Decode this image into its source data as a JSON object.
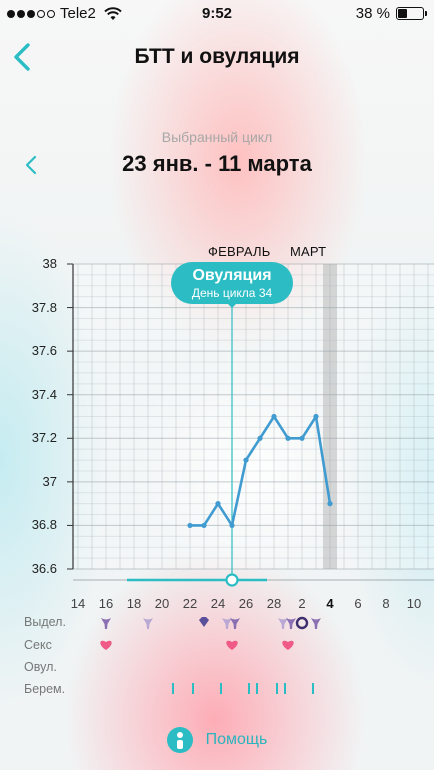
{
  "status_bar": {
    "carrier": "Tele2",
    "time": "9:52",
    "battery_pct": "38 %",
    "battery_level": 0.38,
    "signal_bars_filled": 3,
    "signal_bars_total": 5
  },
  "nav": {
    "back_icon": "chevron-left-icon",
    "title": "БТТ и овуляция"
  },
  "cycle": {
    "caption": "Выбранный цикл",
    "range": "23 янв. - 11 марта",
    "prev_icon": "chevron-left-icon"
  },
  "colors": {
    "accent": "#2cbdc4",
    "line": "#3f9bd0",
    "heart": "#ef5a86",
    "discharge": "#8a6fb3"
  },
  "chart_data": {
    "type": "line",
    "title": "",
    "xlabel": "",
    "ylabel": "",
    "ylim": [
      36.6,
      38
    ],
    "y_ticks": [
      "38",
      "37.8",
      "37.6",
      "37.4",
      "37.2",
      "37",
      "36.8",
      "36.6"
    ],
    "y_tick_values": [
      38,
      37.8,
      37.6,
      37.4,
      37.2,
      37,
      36.8,
      36.6
    ],
    "months": [
      {
        "label": "ФЕВРАЛЬ",
        "at_day": 25
      },
      {
        "label": "МАРТ",
        "at_day": 32
      }
    ],
    "x_tick_labels": [
      "14",
      "16",
      "18",
      "20",
      "22",
      "24",
      "26",
      "28",
      "2",
      "4",
      "6",
      "8",
      "10"
    ],
    "x_tick_days": [
      14,
      16,
      18,
      20,
      22,
      24,
      26,
      28,
      30,
      32,
      34,
      36,
      38
    ],
    "today_label": "4",
    "today_day": 32,
    "grid": true,
    "series": [
      {
        "points": [
          {
            "day": 22,
            "value": 36.8
          },
          {
            "day": 23,
            "value": 36.8
          },
          {
            "day": 24,
            "value": 36.9
          },
          {
            "day": 25,
            "value": 36.8
          },
          {
            "day": 26,
            "value": 37.1
          },
          {
            "day": 27,
            "value": 37.2
          },
          {
            "day": 28,
            "value": 37.3
          },
          {
            "day": 29,
            "value": 37.2
          },
          {
            "day": 30,
            "value": 37.2
          },
          {
            "day": 31,
            "value": 37.3
          },
          {
            "day": 32,
            "value": 36.9
          }
        ]
      }
    ],
    "ovulation": {
      "day": 25,
      "title": "Овуляция",
      "subtitle": "День цикла 34"
    }
  },
  "rows": {
    "discharge": "Выдел.",
    "sex": "Секс",
    "ovulation": "Овул.",
    "pregnancy": "Берем."
  },
  "markers": {
    "discharge": [
      {
        "day": 16,
        "icon": "discharge-icon"
      },
      {
        "day": 19,
        "icon": "discharge-light-icon"
      },
      {
        "day": 23,
        "icon": "discharge-diamond-icon"
      },
      {
        "day": 25,
        "icon": "discharge-double-icon"
      },
      {
        "day": 29,
        "icon": "discharge-double-icon"
      },
      {
        "day": 31,
        "icon": "discharge-icon"
      }
    ],
    "discharge_ring_day": 30,
    "sex": [
      16,
      25,
      29
    ],
    "pregnancy_ticks": [
      21,
      22,
      24,
      26,
      27,
      28,
      29,
      31
    ]
  },
  "help": {
    "label": "Помощь",
    "icon": "info-person-icon"
  }
}
